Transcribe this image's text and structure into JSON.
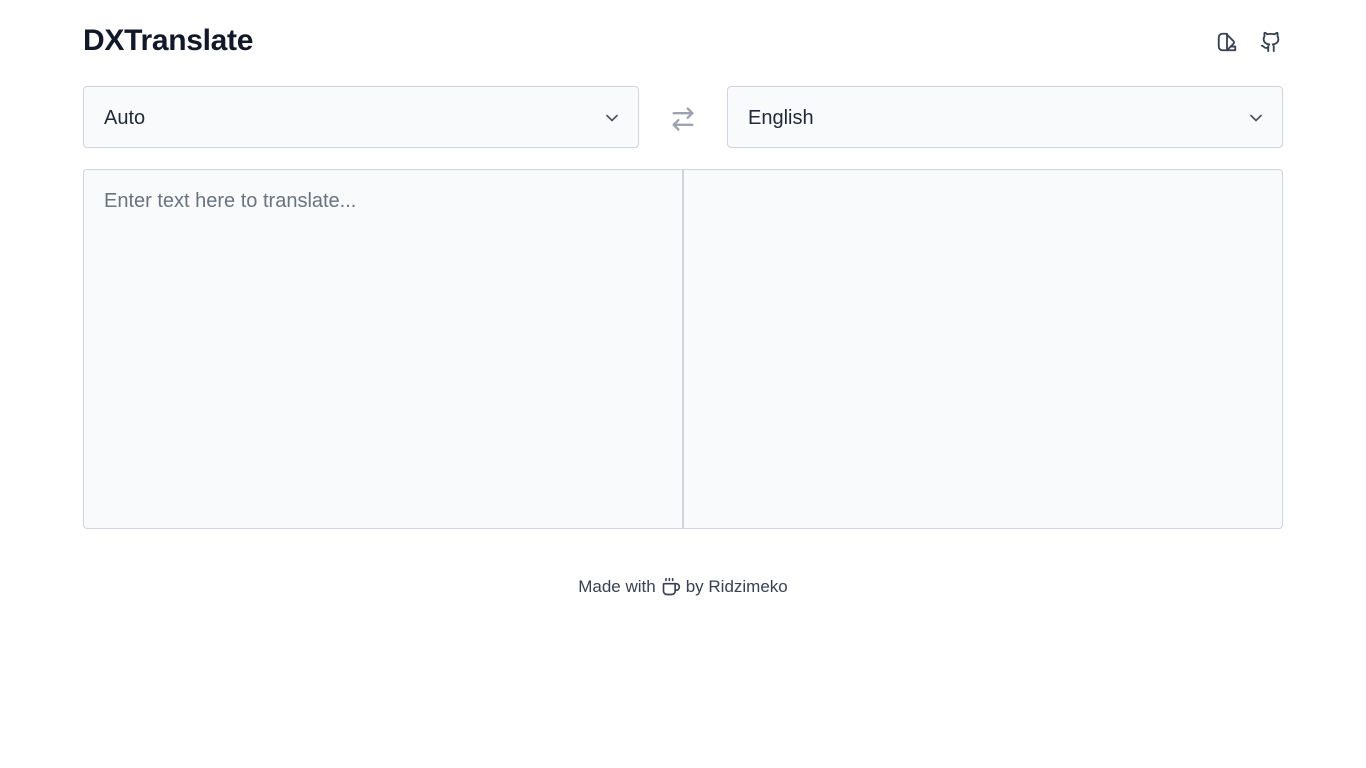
{
  "header": {
    "title": "DXTranslate",
    "theme_icon": "theme-toggle-icon",
    "github_icon": "github-icon"
  },
  "languages": {
    "source": "Auto",
    "target": "English",
    "swap_icon": "swap-arrows-icon"
  },
  "editor": {
    "source_placeholder": "Enter text here to translate...",
    "source_value": "",
    "output_value": ""
  },
  "footer": {
    "made_with": "Made with",
    "cup_icon": "coffee-cup-icon",
    "by": "by Ridzimeko"
  }
}
